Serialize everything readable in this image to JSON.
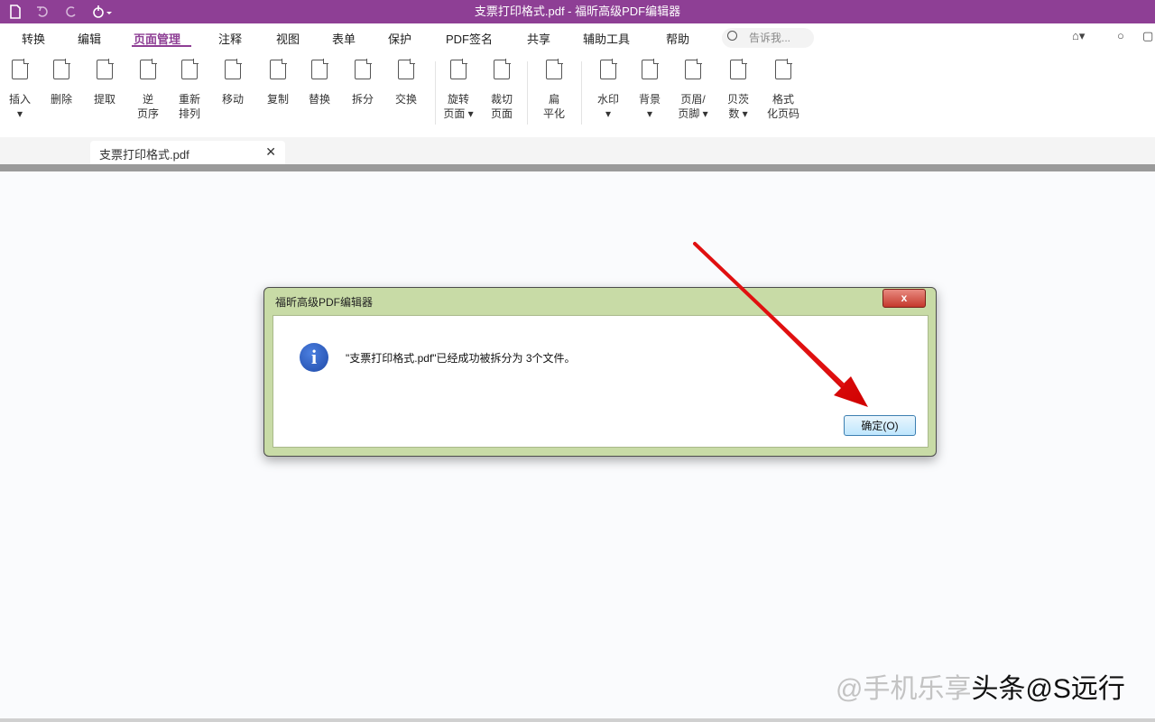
{
  "window": {
    "title": "支票打印格式.pdf - 福昕高级PDF编辑器"
  },
  "quick_access": {
    "icons": [
      "document-icon",
      "undo-icon",
      "redo-icon",
      "hand-icon"
    ]
  },
  "menu": {
    "items": [
      "转换",
      "编辑",
      "页面管理",
      "注释",
      "视图",
      "表单",
      "保护",
      "PDF签名",
      "共享",
      "辅助工具",
      "帮助"
    ],
    "active": "页面管理",
    "search_placeholder": "告诉我..."
  },
  "ribbon": {
    "tools": [
      {
        "label": "插入\n▾",
        "icon": "insert-page-icon"
      },
      {
        "label": "删除",
        "icon": "delete-page-icon"
      },
      {
        "label": "提取",
        "icon": "extract-page-icon"
      },
      {
        "label": "逆\n页序",
        "icon": "reverse-pages-icon"
      },
      {
        "label": "重新\n排列",
        "icon": "rearrange-icon"
      },
      {
        "label": "移动",
        "icon": "move-page-icon"
      },
      {
        "label": "复制",
        "icon": "copy-page-icon"
      },
      {
        "label": "替换",
        "icon": "replace-page-icon"
      },
      {
        "label": "拆分",
        "icon": "split-icon"
      },
      {
        "label": "交换",
        "icon": "swap-icon"
      },
      {
        "label": "旋转\n页面 ▾",
        "icon": "rotate-page-icon"
      },
      {
        "label": "裁切\n页面",
        "icon": "crop-page-icon"
      },
      {
        "label": "扁\n平化",
        "icon": "flatten-icon"
      },
      {
        "label": "水印\n▾",
        "icon": "watermark-icon"
      },
      {
        "label": "背景\n▾",
        "icon": "background-icon"
      },
      {
        "label": "页眉/\n页脚 ▾",
        "icon": "header-footer-icon"
      },
      {
        "label": "贝茨\n数 ▾",
        "icon": "bates-number-icon"
      },
      {
        "label": "格式\n化页码",
        "icon": "format-page-number-icon"
      }
    ]
  },
  "tabs": [
    {
      "label": "支票打印格式.pdf",
      "close": "✕"
    }
  ],
  "dialog": {
    "title": "福昕高级PDF编辑器",
    "close_label": "x",
    "message": "\"支票打印格式.pdf\"已经成功被拆分为 3个文件。",
    "ok_label": "确定(O)"
  },
  "watermark": {
    "prefix": "@手机乐享",
    "suffix": "头条@S远行"
  },
  "colors": {
    "accent": "#8e3f95",
    "dialog_frame": "#c8dba6",
    "arrow": "#e01010"
  }
}
